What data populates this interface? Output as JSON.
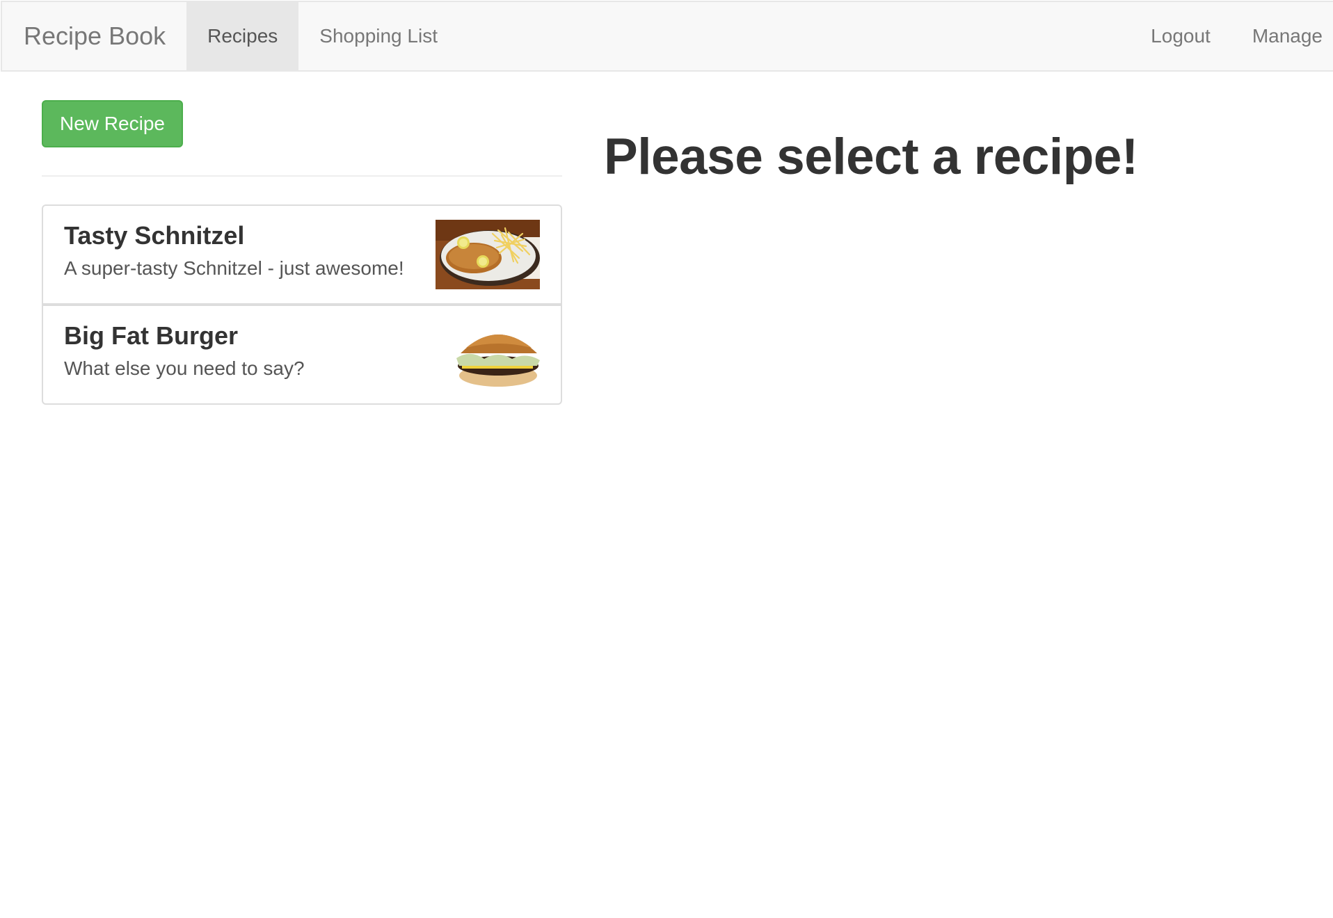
{
  "navbar": {
    "brand": "Recipe Book",
    "left_items": [
      {
        "label": "Recipes",
        "active": true
      },
      {
        "label": "Shopping List",
        "active": false
      }
    ],
    "right_items": [
      {
        "label": "Logout"
      },
      {
        "label": "Manage"
      }
    ]
  },
  "sidebar": {
    "new_button_label": "New Recipe",
    "button_color": "#5cb85c",
    "recipes": [
      {
        "name": "Tasty Schnitzel",
        "description": "A super-tasty Schnitzel - just awesome!",
        "image_icon": "schnitzel-image"
      },
      {
        "name": "Big Fat Burger",
        "description": "What else you need to say?",
        "image_icon": "burger-image"
      }
    ]
  },
  "main": {
    "message": "Please select a recipe!"
  }
}
